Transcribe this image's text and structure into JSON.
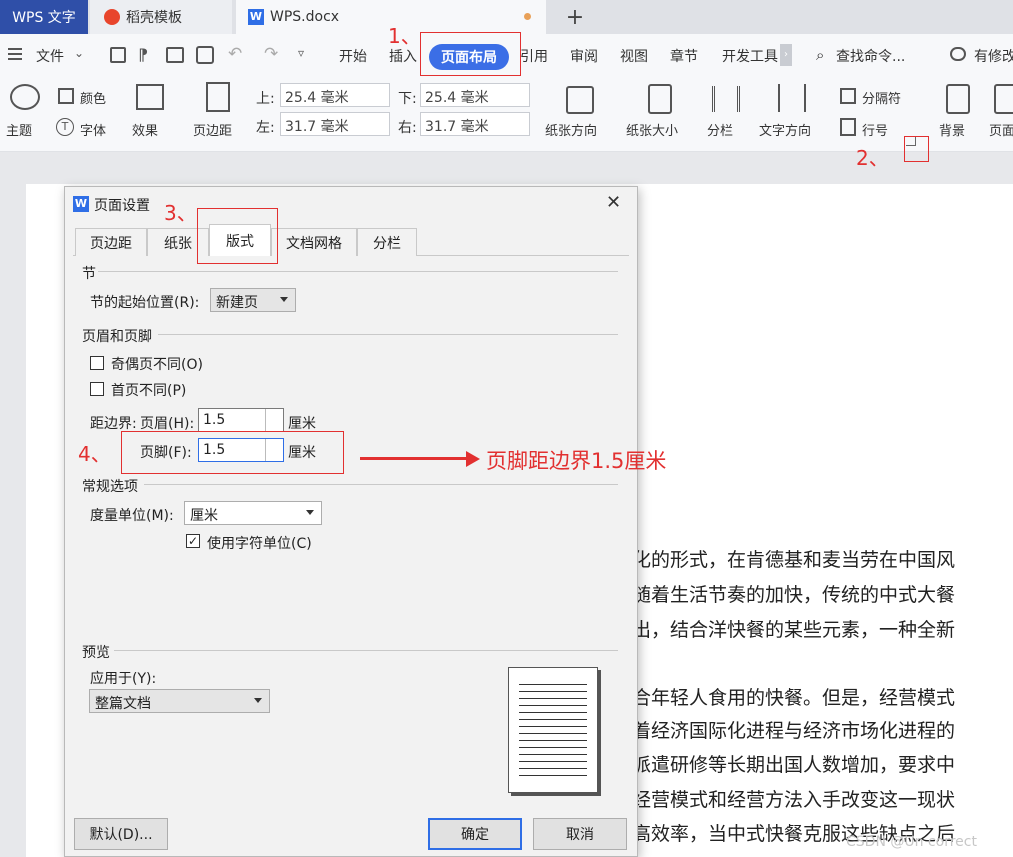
{
  "titlebar": {
    "tabs": [
      {
        "label": "WPS 文字"
      },
      {
        "label": "稻壳模板"
      },
      {
        "label": "WPS.docx"
      }
    ],
    "new_tab": "+"
  },
  "menubar": {
    "file": "文件",
    "items": [
      "开始",
      "插入",
      "页面布局",
      "引用",
      "审阅",
      "视图",
      "章节",
      "开发工具"
    ],
    "active": "页面布局",
    "search": "查找命令...",
    "modified": "有修改"
  },
  "ribbon": {
    "theme": "主题",
    "color": "颜色",
    "font": "字体",
    "effect": "效果",
    "margin": "页边距",
    "top_label": "上:",
    "top_value": "25.4 毫米",
    "bottom_label": "下:",
    "bottom_value": "25.4 毫米",
    "left_label": "左:",
    "left_value": "31.7 毫米",
    "right_label": "右:",
    "right_value": "31.7 毫米",
    "orientation": "纸张方向",
    "size": "纸张大小",
    "columns": "分栏",
    "text_direction": "文字方向",
    "separator": "分隔符",
    "line_number": "行号",
    "background": "背景",
    "page_border": "页面"
  },
  "annotations": {
    "step1": "1、",
    "step2": "2、",
    "step3": "3、",
    "step4": "4、",
    "arrow_note": "页脚距边界1.5厘米"
  },
  "dialog": {
    "title": "页面设置",
    "tabs": [
      "页边距",
      "纸张",
      "版式",
      "文档网格",
      "分栏"
    ],
    "active_tab": "版式",
    "section_head": "节",
    "section_start_label": "节的起始位置(R):",
    "section_start_value": "新建页",
    "header_footer_head": "页眉和页脚",
    "odd_even": "奇偶页不同(O)",
    "first_page": "首页不同(P)",
    "distance_label": "距边界:",
    "header_label": "页眉(H):",
    "header_value": "1.5",
    "header_unit": "厘米",
    "footer_label": "页脚(F):",
    "footer_value": "1.5",
    "footer_unit": "厘米",
    "general_head": "常规选项",
    "measure_label": "度量单位(M):",
    "measure_value": "厘米",
    "char_unit": "使用字符单位(C)",
    "char_unit_checked": true,
    "preview_head": "预览",
    "apply_label": "应用于(Y):",
    "apply_value": "整篇文档",
    "default_btn": "默认(D)...",
    "ok_btn": "确定",
    "cancel_btn": "取消"
  },
  "document": {
    "lines": [
      "化的形式，在肯德基和麦当劳在中国风",
      "随着生活节奏的加快，传统的中式大餐",
      "出，结合洋快餐的某些元素，一种全新",
      "",
      "合年轻人食用的快餐。但是，经营模式",
      "着经济国际化进程与经济市场化进程的",
      "派遣研修等长期出国人数增加，要求中",
      "经营模式和经营方法入手改变这一现状",
      "高效率，当中式快餐克服这些缺点之后"
    ]
  },
  "watermark": "CSDN @Un correct"
}
